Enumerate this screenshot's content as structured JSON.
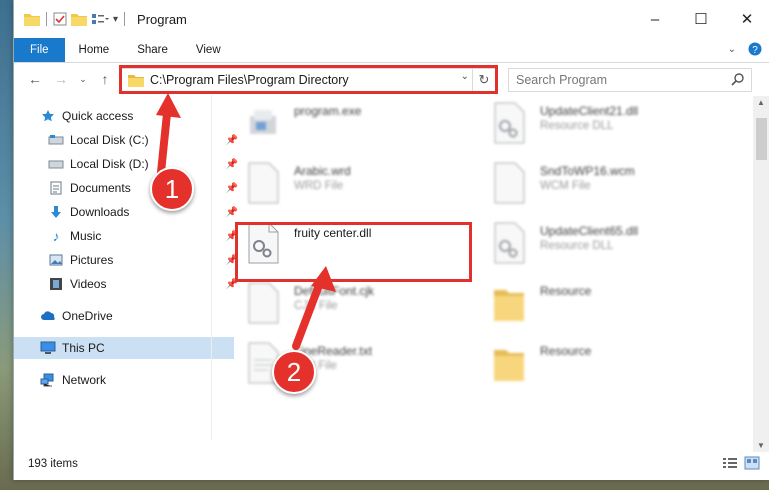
{
  "window": {
    "title": "Program",
    "controls": {
      "minimize": "–",
      "maximize": "☐",
      "close": "✕"
    }
  },
  "ribbon": {
    "tabs": [
      "File",
      "Home",
      "Share",
      "View"
    ]
  },
  "address": {
    "path": "C:\\Program Files\\Program Directory"
  },
  "search": {
    "placeholder": "Search Program"
  },
  "sidebar": {
    "items": [
      {
        "label": "Quick access",
        "icon": "star-icon"
      },
      {
        "label": "Local Disk (C:)",
        "icon": "drive-icon",
        "pinned": true
      },
      {
        "label": "Local Disk (D:)",
        "icon": "drive-icon",
        "pinned": true
      },
      {
        "label": "Documents",
        "icon": "documents-icon",
        "pinned": true
      },
      {
        "label": "Downloads",
        "icon": "download-icon",
        "pinned": true
      },
      {
        "label": "Music",
        "icon": "music-icon",
        "pinned": true
      },
      {
        "label": "Pictures",
        "icon": "pictures-icon",
        "pinned": true
      },
      {
        "label": "Videos",
        "icon": "videos-icon",
        "pinned": true
      },
      {
        "label": "OneDrive",
        "icon": "cloud-icon"
      },
      {
        "label": "This PC",
        "icon": "computer-icon",
        "selected": true
      },
      {
        "label": "Network",
        "icon": "network-icon"
      }
    ]
  },
  "files": [
    {
      "name": "program.exe",
      "type": "",
      "icon": "exe-icon"
    },
    {
      "name": "UpdateClient21.dll",
      "type": "Resource DLL",
      "icon": "dll-icon"
    },
    {
      "name": "Arabic.wrd",
      "type": "WRD File",
      "icon": "file-icon"
    },
    {
      "name": "SndToWP16.wcm",
      "type": "WCM File",
      "icon": "file-icon"
    },
    {
      "name": "fruity center.dll",
      "type": "",
      "icon": "dll-icon"
    },
    {
      "name": "UpdateClient65.dll",
      "type": "Resource DLL",
      "icon": "dll-icon"
    },
    {
      "name": "DefaultFont.cjk",
      "type": "CJK File",
      "icon": "file-icon"
    },
    {
      "name": "Resource",
      "type": "",
      "icon": "folder-icon"
    },
    {
      "name": "FineReader.txt",
      "type": "Text File",
      "icon": "text-icon"
    },
    {
      "name": "Resource",
      "type": "",
      "icon": "folder-icon"
    }
  ],
  "status": {
    "count": "193 items"
  },
  "callouts": [
    "1",
    "2"
  ],
  "colors": {
    "accent": "#1979ca",
    "highlight": "#e0312c",
    "selected": "#cce0f4"
  }
}
